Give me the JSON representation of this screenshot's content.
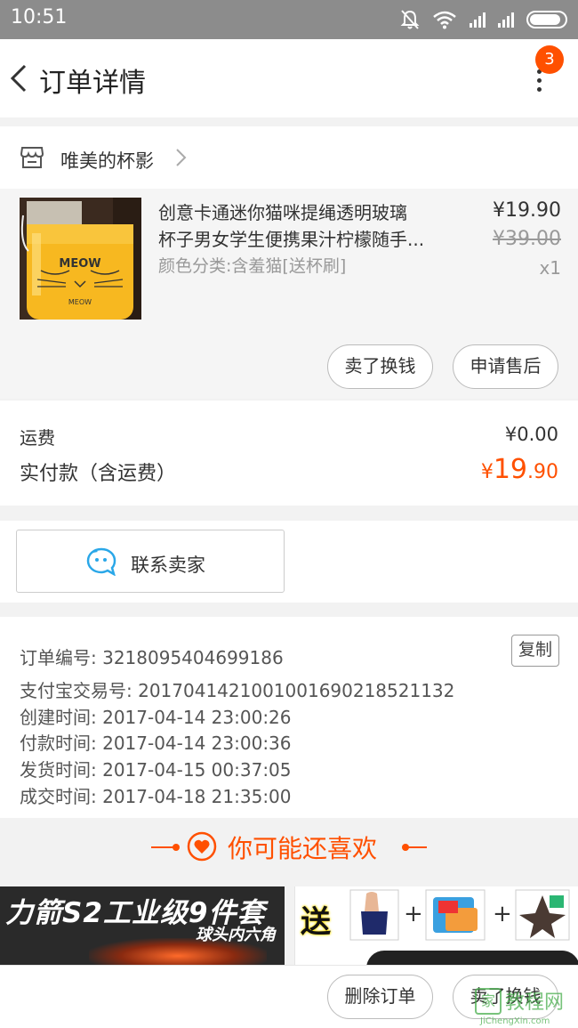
{
  "status_bar": {
    "time": "10:51"
  },
  "header": {
    "title": "订单详情",
    "badge_count": "3"
  },
  "shop": {
    "name": "唯美的杯影"
  },
  "item": {
    "name_line1": "创意卡通迷你猫咪提绳透明玻璃",
    "name_line2": "杯子男女学生便携果汁柠檬随手...",
    "sku": "颜色分类:含羞猫[送杯刷]",
    "price": "¥19.90",
    "original_price": "¥39.00",
    "quantity": "x1",
    "jar_label_top": "MEOW",
    "jar_label_bottom": "MEOW",
    "actions": {
      "sell": "卖了换钱",
      "after_sale": "申请售后"
    }
  },
  "fees": {
    "shipping_label": "运费",
    "shipping_value": "¥0.00",
    "paid_label": "实付款（含运费）",
    "paid_symbol": "¥",
    "paid_int": "19",
    "paid_dec": ".90"
  },
  "contact": {
    "label": "联系卖家"
  },
  "order_info": {
    "copy_label": "复制",
    "rows": [
      "订单编号: 3218095404699186",
      "支付宝交易号: 2017041421001001690218521132",
      "创建时间: 2017-04-14 23:00:26",
      "付款时间: 2017-04-14 23:00:36",
      "发货时间: 2017-04-15 00:37:05",
      "成交时间: 2017-04-18 21:35:00"
    ]
  },
  "recommend": {
    "title": "你可能还喜欢"
  },
  "ads": {
    "ad1_title": "力箭S2工业级9件套",
    "ad1_sub": "球头内六角",
    "ad2_title": "送",
    "ad2_plus": "+"
  },
  "bottom_bar": {
    "delete_order": "删除订单",
    "sell": "卖了换钱"
  },
  "watermark": {
    "logo": "家",
    "text": "教程网",
    "url": "JiChengXin.com"
  },
  "colors": {
    "accent": "#ff5000",
    "contact_icon": "#2aa7e8"
  }
}
